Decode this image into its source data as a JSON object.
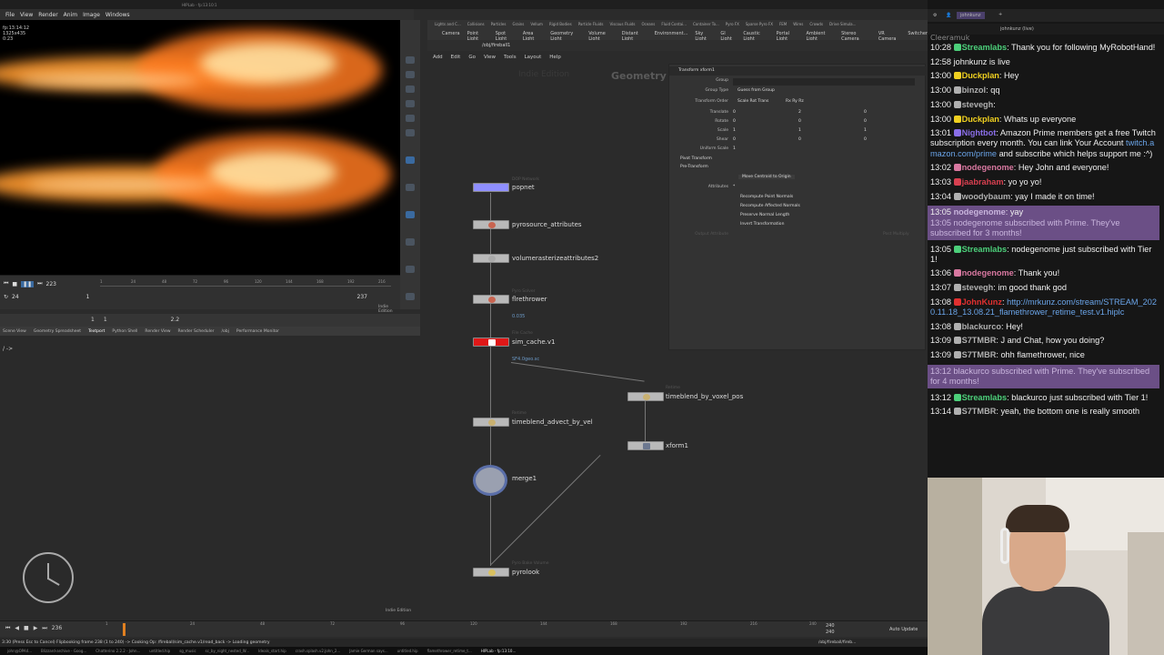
{
  "window": {
    "title": "HIPLab - fp:13:10:1",
    "indie_label": "Indie Edition"
  },
  "menubar": [
    "File",
    "View",
    "Render",
    "Anim",
    "Image",
    "Windows"
  ],
  "viewer": {
    "hud": [
      "fp:13:14:12",
      "1325x435",
      "0:23"
    ],
    "current_frame": "223",
    "start_frame": "1",
    "end_frame": "237",
    "fps": "24",
    "frame_field": "1",
    "zoom_field": "1",
    "gamma": "2.2",
    "ticks": [
      "1",
      "24",
      "48",
      "72",
      "96",
      "120",
      "144",
      "168",
      "192",
      "216"
    ]
  },
  "lower_tabs": [
    "Scene View",
    "Geometry Spreadsheet",
    "Textport",
    "Python Shell",
    "Render View",
    "Render Scheduler",
    "/obj",
    "Performance Monitor"
  ],
  "textport_prompt": "/ ->",
  "shelf_tabs": [
    "Lights and C...",
    "Collisions",
    "Particles",
    "Grains",
    "Vellum",
    "Rigid Bodies",
    "Particle Fluids",
    "Viscous Fluids",
    "Oceans",
    "Fluid Contai...",
    "Container To...",
    "Pyro FX",
    "Sparse Pyro FX",
    "FEM",
    "Wires",
    "Crowds",
    "Drive Simula..."
  ],
  "shelf_tools": [
    "Camera",
    "Point Light",
    "Spot Light",
    "Area Light",
    "Geometry Light",
    "Volume Light",
    "Distant Light",
    "Environment...",
    "Sky Light",
    "GI Light",
    "Caustic Light",
    "Portal Light",
    "Ambient Light",
    "Stereo Camera",
    "VR Camera",
    "Switcher"
  ],
  "network": {
    "path": "/obj/fireball1",
    "menu": [
      "Add",
      "Edit",
      "Go",
      "View",
      "Tools",
      "Layout",
      "Help"
    ],
    "context_label": "Geometry",
    "indie_watermark": "Indie Edition",
    "nodes": [
      {
        "name": "popnet",
        "type": "DOP Network",
        "color": "#8f8fff"
      },
      {
        "name": "pyrosource_attributes",
        "type": "",
        "color": "#b9b9b9"
      },
      {
        "name": "volumerasterizeattributes2",
        "type": "",
        "color": "#b9b9b9"
      },
      {
        "name": "flrethrower",
        "type": "Pyro Solver",
        "color": "#b9b9b9",
        "sub": "0.035"
      },
      {
        "name": "sim_cache.v1",
        "type": "File Cache",
        "color": "#e01818",
        "sub": "SF4.0geo.sc"
      },
      {
        "name": "timeblend_advect_by_vel",
        "type": "Retime",
        "color": "#b9b9b9"
      },
      {
        "name": "timeblend_by_voxel_pos",
        "type": "Retime",
        "color": "#b9b9b9"
      },
      {
        "name": "xform1",
        "type": "",
        "color": "#b9b9b9"
      },
      {
        "name": "merge1",
        "type": "",
        "color": "#9aa0b0"
      },
      {
        "name": "pyrolook",
        "type": "Pyro Bake Volume",
        "color": "#b9b9b9"
      }
    ]
  },
  "params": {
    "header": "Transform  xform1",
    "group_label": "Group",
    "group_type_label": "Group Type",
    "group_type_value": "Guess from Group",
    "transform_order_label": "Transform Order",
    "transform_order_value": "Scale Rot Trans",
    "rot_order_value": "Rx Ry Rz",
    "rows": [
      {
        "label": "Translate",
        "values": [
          "0",
          "2",
          "0"
        ]
      },
      {
        "label": "Rotate",
        "values": [
          "0",
          "0",
          "0"
        ]
      },
      {
        "label": "Scale",
        "values": [
          "1",
          "1",
          "1"
        ]
      },
      {
        "label": "Shear",
        "values": [
          "0",
          "0",
          "0"
        ]
      }
    ],
    "uniform_scale_label": "Uniform Scale",
    "uniform_scale_value": "1",
    "pivot_transform": "Pivot Transform",
    "pre_transform": "Pre-Transform",
    "move_centroid": "Move Centroid to Origin",
    "attributes_label": "Attributes",
    "attributes_value": "*",
    "checks": [
      "Recompute Point Normals",
      "Recompute Affected Normals",
      "Preserve Normal Length",
      "Invert Transformation"
    ],
    "output_attr_label": "Output Attribute",
    "output_attr_right": "Post Multiply"
  },
  "chat": {
    "tab": "johnkunz",
    "title": "johnkunz (live)",
    "partial_top": "Cleeramuk",
    "messages": [
      {
        "time": "10:28",
        "user": "Streamlabs",
        "color": "#4ccf7a",
        "text": ": Thank you for following MyRobotHand!"
      },
      {
        "time": "12:58",
        "user": "",
        "color": "",
        "text": "johnkunz is live"
      },
      {
        "time": "13:00",
        "user": "Duckplan",
        "color": "#f0d020",
        "text": ": Hey"
      },
      {
        "time": "13:00",
        "user": "binzol",
        "color": "#b0b0b0",
        "text": ": qq"
      },
      {
        "time": "13:00",
        "user": "stevegh",
        "color": "#b0b0b0",
        "text": ":"
      },
      {
        "time": "13:00",
        "user": "Duckplan",
        "color": "#f0d020",
        "text": ": Whats up everyone"
      },
      {
        "time": "13:01",
        "user": "Nightbot",
        "color": "#8a6ee8",
        "text": ": Amazon Prime members get a free Twitch subscription every month. You can link Your Account ",
        "link": "twitch.amazon.com/prime",
        "text2": " and subscribe which helps support me :^)"
      },
      {
        "time": "13:02",
        "user": "nodegenome",
        "color": "#d878a0",
        "text": ": Hey John and everyone!"
      },
      {
        "time": "13:03",
        "user": "jaabraham",
        "color": "#d84050",
        "text": ": yo yo yo!"
      },
      {
        "time": "13:04",
        "user": "woodybaum",
        "color": "#b0b0b0",
        "text": ": yay I made it on time!"
      },
      {
        "time": "13:05",
        "user": "nodegenome",
        "color": "#d878a0",
        "text": ": yay",
        "highlight": true,
        "sub": "13:05 nodegenome subscribed with Prime. They've subscribed for 3 months!"
      },
      {
        "time": "13:05",
        "user": "Streamlabs",
        "color": "#4ccf7a",
        "text": ": nodegenome just subscribed with Tier 1!"
      },
      {
        "time": "13:06",
        "user": "nodegenome",
        "color": "#d878a0",
        "text": ": Thank you!"
      },
      {
        "time": "13:07",
        "user": "stevegh",
        "color": "#b0b0b0",
        "text": ": im good thank god"
      },
      {
        "time": "13:08",
        "user": "JohnKunz",
        "color": "#e03030",
        "text": ": ",
        "link": "http://mrkunz.com/stream/STREAM_2020.11.18_13.08.21_flamethrower_retime_test.v1.hiplc"
      },
      {
        "time": "13:08",
        "user": "blackurco",
        "color": "#b0b0b0",
        "text": ": Hey!"
      },
      {
        "time": "13:09",
        "user": "S7TMBR",
        "color": "#b0b0b0",
        "text": ": J and Chat, how you doing?"
      },
      {
        "time": "13:09",
        "user": "S7TMBR",
        "color": "#b0b0b0",
        "text": ": ohh flamethrower, nice"
      },
      {
        "time": "13:12",
        "user": "",
        "color": "",
        "text": "",
        "highlight": true,
        "sub": "13:12 blackurco subscribed with Prime. They've subscribed for 4 months!"
      },
      {
        "time": "13:12",
        "user": "Streamlabs",
        "color": "#4ccf7a",
        "text": ": blackurco just subscribed with Tier 1!"
      },
      {
        "time": "13:14",
        "user": "S7TMBR",
        "color": "#b0b0b0",
        "text": ": yeah, the bottom one is really smooth"
      }
    ]
  },
  "timeline": {
    "current": "236",
    "ticks": [
      "1",
      "24",
      "48",
      "72",
      "96",
      "120",
      "144",
      "168",
      "192",
      "216",
      "240"
    ],
    "end1": "240",
    "end2": "240",
    "auto_update": "Auto Update"
  },
  "status": "3:30 (Press Esc to Cancel) Flipbooking frame 238 (1 to 240) -> Cooking Op: /fireball/sim_cache.v1/read_back -> Loading geometry",
  "status_right": "/obj/fireball/fireb...",
  "taskbar": [
    "john@OPA4...",
    "Blizzard-archive - Goog...",
    "Chatterino 2.2.2 - John...",
    "untitled.hip",
    "sg_music",
    "sc_by_night_nested_W...",
    "Ideals_start.hip",
    "crash.splash.v2.John_2...",
    "Jamie German says...",
    "untitled.hip",
    "flamethrower_retime_t...",
    "HIPLab - fp:13:10..."
  ]
}
